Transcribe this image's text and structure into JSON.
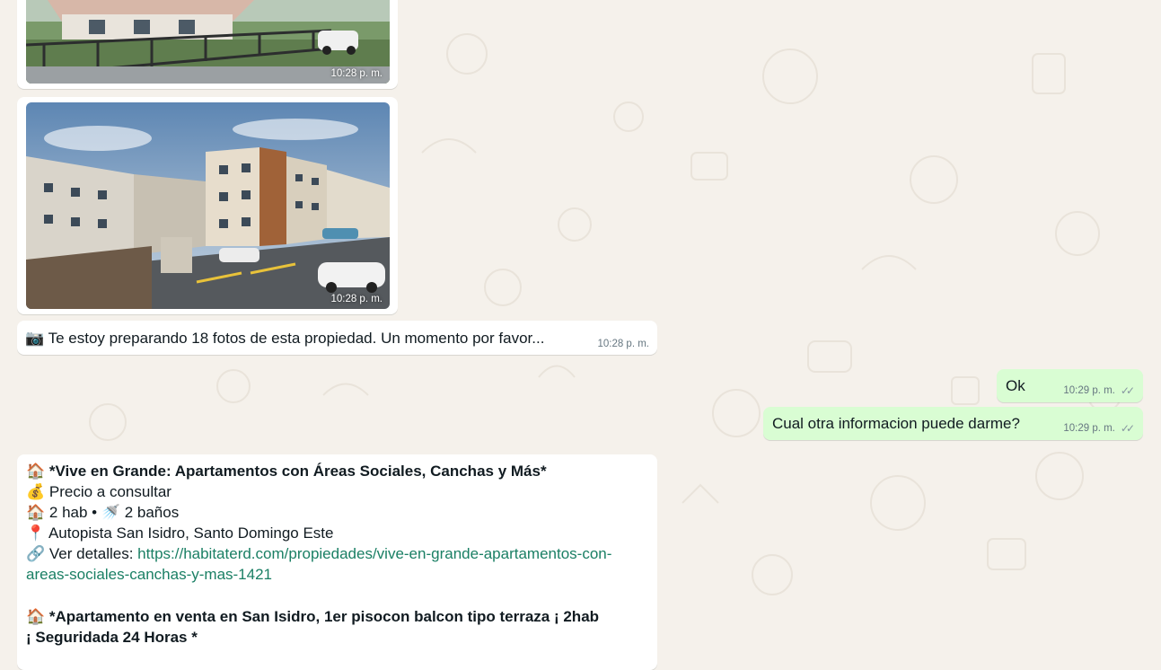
{
  "messages": {
    "photo1": {
      "time": "10:28 p. m."
    },
    "photo2": {
      "time": "10:28 p. m."
    },
    "notice": {
      "icon": "camera-icon",
      "text": "📷 Te estoy preparando 18 fotos de esta propiedad. Un momento por favor...",
      "time": "10:28 p. m."
    },
    "reply_ok": {
      "text": "Ok",
      "time": "10:29 p. m.",
      "status": "✓✓"
    },
    "reply_question": {
      "text": "Cual otra informacion puede darme?",
      "time": "10:29 p. m.",
      "status": "✓✓"
    },
    "listing": {
      "item1": {
        "title": "🏠 *Vive en Grande: Apartamentos con Áreas Sociales, Canchas y Más*",
        "price": "💰 Precio a consultar",
        "rooms": "🏠 2 hab • 🚿 2 baños",
        "location": "📍 Autopista San Isidro, Santo Domingo Este",
        "details_label": "🔗 Ver detalles: ",
        "url_part1": "https://habitaterd.com/propiedades/vive-en-grande-apartamentos-con-",
        "url_part2": "areas-sociales-canchas-y-mas-1421"
      },
      "item2": {
        "title_line1": "🏠 *Apartamento en venta en San Isidro, 1er pisocon balcon tipo terraza ¡ 2hab",
        "title_line2": "¡ Seguridada 24 Horas *"
      }
    }
  },
  "colors": {
    "incoming_bubble": "#ffffff",
    "outgoing_bubble": "#d9fdd3",
    "link": "#1a7f64",
    "wallpaper": "#f5f1eb"
  }
}
